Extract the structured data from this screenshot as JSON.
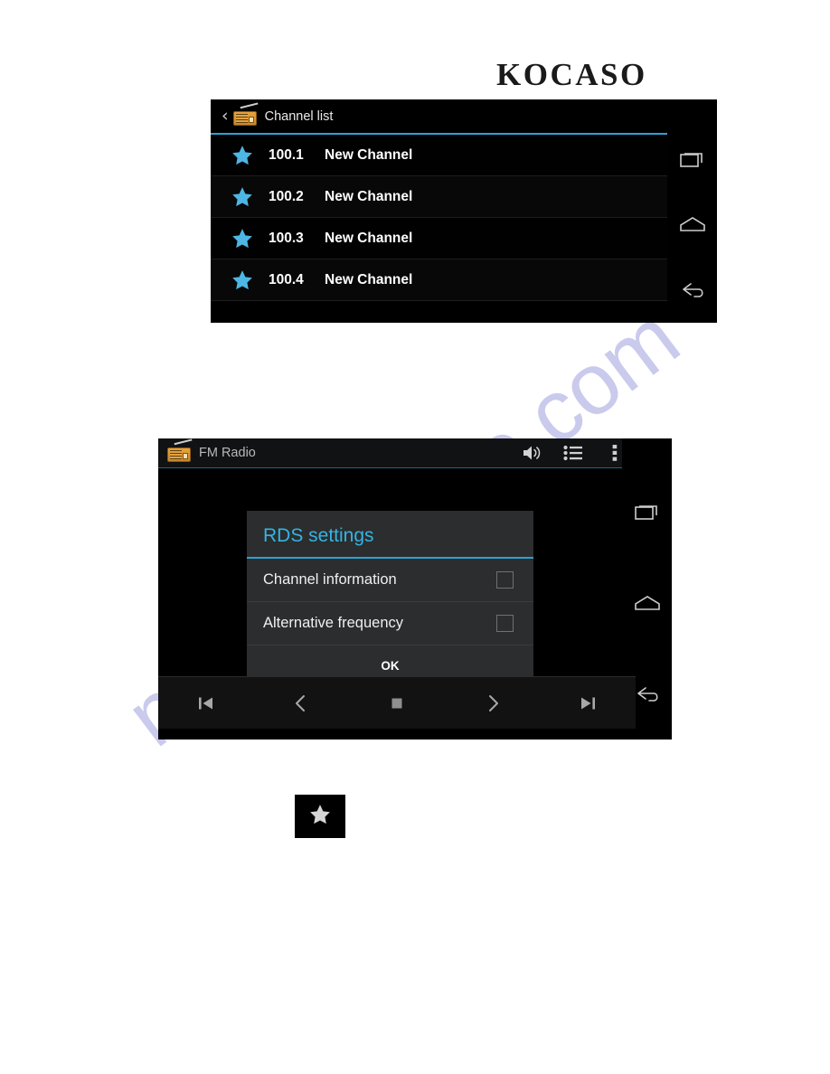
{
  "brand": {
    "logo_text": "KOCASO"
  },
  "watermark": {
    "text": "manualshive.com",
    "color": "#b9b9e8"
  },
  "colors": {
    "accent_blue": "#2aa3d6",
    "dialog_title_blue": "#34b4e4",
    "star_blue": "#4db6e4",
    "radio_icon_orange": "#e8a33d",
    "screen_black": "#000000",
    "dialog_gray": "#2b2d2e"
  },
  "channel_list_screen": {
    "header": {
      "back_label": "‹",
      "icon": "radio-icon",
      "title": "Channel list"
    },
    "rows": [
      {
        "star": "star-icon",
        "frequency": "100.1",
        "name": "New Channel"
      },
      {
        "star": "star-icon",
        "frequency": "100.2",
        "name": "New Channel"
      },
      {
        "star": "star-icon",
        "frequency": "100.3",
        "name": "New Channel"
      },
      {
        "star": "star-icon",
        "frequency": "100.4",
        "name": "New Channel"
      }
    ],
    "nav_rail": [
      {
        "icon": "recents-icon",
        "label": "Recents"
      },
      {
        "icon": "home-icon",
        "label": "Home"
      },
      {
        "icon": "back-icon",
        "label": "Back"
      }
    ]
  },
  "fm_radio_screen": {
    "titlebar": {
      "icon": "radio-icon",
      "title": "FM Radio",
      "actions": [
        {
          "icon": "volume-icon",
          "label": "Volume"
        },
        {
          "icon": "list-icon",
          "label": "Channel list"
        },
        {
          "icon": "overflow-menu-icon",
          "label": "More options"
        }
      ]
    },
    "dialog": {
      "title": "RDS settings",
      "options": [
        {
          "label": "Channel information",
          "checked": false
        },
        {
          "label": "Alternative frequency",
          "checked": false
        }
      ],
      "ok_label": "OK"
    },
    "transport": [
      {
        "icon": "skip-previous-icon",
        "label": "Skip previous"
      },
      {
        "icon": "seek-backward-icon",
        "label": "Seek backward"
      },
      {
        "icon": "stop-icon",
        "label": "Stop"
      },
      {
        "icon": "seek-forward-icon",
        "label": "Seek forward"
      },
      {
        "icon": "skip-next-icon",
        "label": "Skip next"
      }
    ],
    "nav_rail": [
      {
        "icon": "recents-icon",
        "label": "Recents"
      },
      {
        "icon": "home-icon",
        "label": "Home"
      },
      {
        "icon": "back-icon",
        "label": "Back"
      }
    ]
  },
  "standalone_icon": {
    "icon": "star-icon",
    "label": "Favorite star"
  }
}
